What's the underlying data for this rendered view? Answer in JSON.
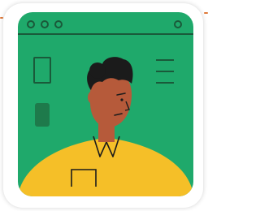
{
  "illustration": {
    "colors": {
      "background": "#ffffff",
      "card": "#ffffff",
      "window": "#1FA96B",
      "window_line": "#1A5A3A",
      "tab_block": "#1E7A4B",
      "skin": "#B65A3A",
      "hair": "#1B1B1B",
      "shirt": "#F5BF28",
      "outline": "#1B1B1B",
      "accent": "#E07A3A"
    },
    "icons": [
      "window-dots-icon",
      "hamburger-menu-icon",
      "person-avatar-icon"
    ]
  }
}
